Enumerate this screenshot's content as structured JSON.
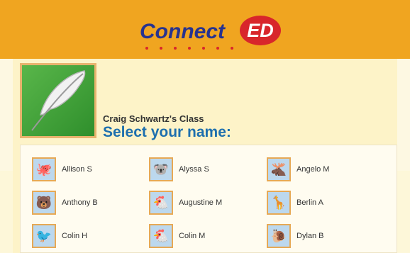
{
  "logo": {
    "word": "Connect",
    "badge": "ED"
  },
  "class_name": "Craig Schwartz's Class",
  "select_title": "Select your name:",
  "students": [
    {
      "name": "Allison S",
      "icon": "octopus-icon",
      "glyph": "🐙"
    },
    {
      "name": "Alyssa S",
      "icon": "koala-icon",
      "glyph": "🐨"
    },
    {
      "name": "Angelo M",
      "icon": "moose-icon",
      "glyph": "🫎"
    },
    {
      "name": "Anthony B",
      "icon": "bear-icon",
      "glyph": "🐻"
    },
    {
      "name": "Augustine M",
      "icon": "chicken-icon",
      "glyph": "🐔"
    },
    {
      "name": "Berlin A",
      "icon": "giraffe-icon",
      "glyph": "🦒"
    },
    {
      "name": "Colin H",
      "icon": "toucan-icon",
      "glyph": "🐦"
    },
    {
      "name": "Colin M",
      "icon": "chicken-icon",
      "glyph": "🐔"
    },
    {
      "name": "Dylan B",
      "icon": "snail-icon",
      "glyph": "🐌"
    }
  ],
  "colors": {
    "header": "#f0a520",
    "title_blue": "#1d6fae",
    "logo_navy": "#27338f",
    "logo_red": "#d8262b"
  }
}
